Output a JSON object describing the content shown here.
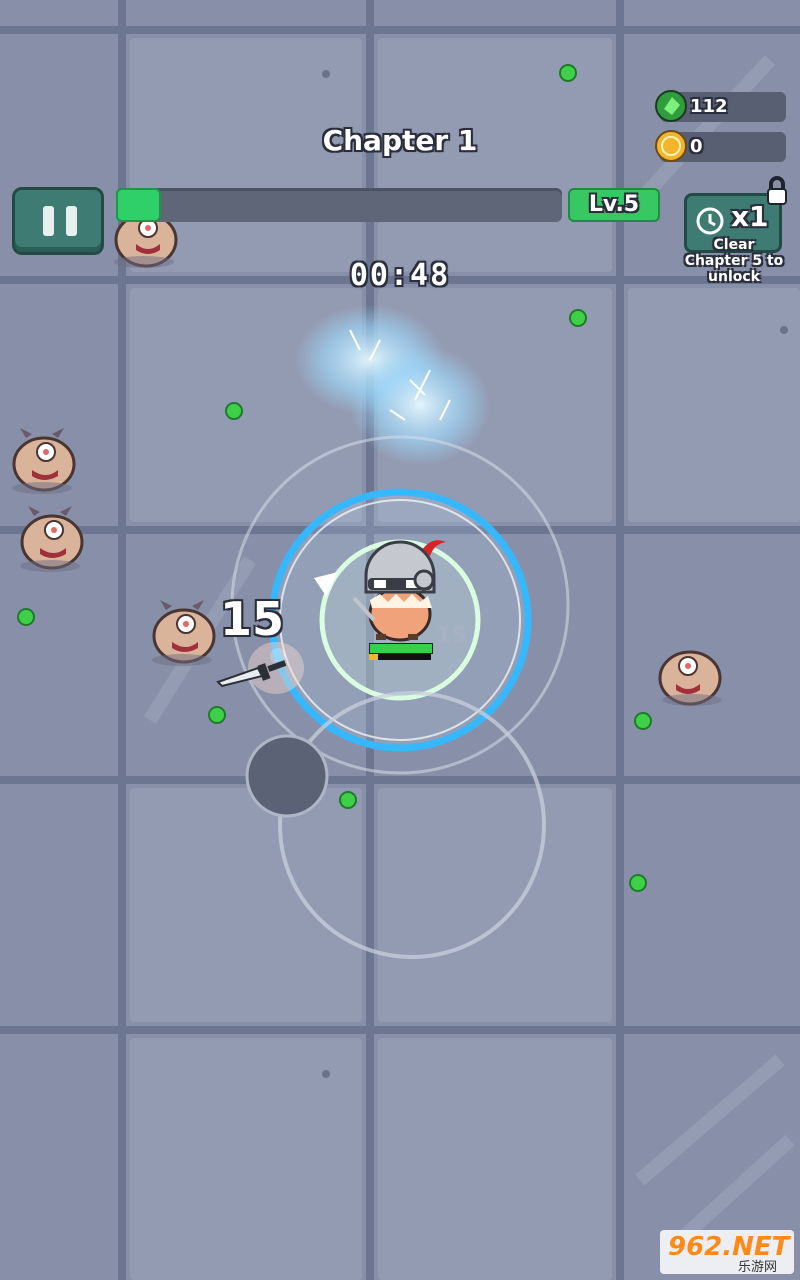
{
  "hud": {
    "chapter_title": "Chapter 1",
    "level_label": "Lv.5",
    "timer": "00:48",
    "xp_progress": 0.1,
    "gems": "112",
    "coins": "0",
    "speed_multiplier": "x1",
    "speed_lock_note_line1": "Clear",
    "speed_lock_note_line2": "Chapter 5 to",
    "speed_lock_note_line3": "unlock"
  },
  "combat": {
    "damage_number_large": "15",
    "damage_number_small": "15",
    "player_hp": 1.0,
    "player_xp": 0.15
  },
  "watermark": {
    "main": "962.NET",
    "sub": "乐游网"
  },
  "colors": {
    "floor": "#8790a8",
    "grid_line": "#6d7690",
    "button_teal": "#3e7b72",
    "xp_green": "#2fd06a",
    "gem_green": "#3fd04a",
    "shield_blue": "#35b8ff"
  },
  "icons": [
    "pause-icon",
    "gem-icon",
    "coin-icon",
    "clock-speed-icon",
    "lock-icon"
  ]
}
